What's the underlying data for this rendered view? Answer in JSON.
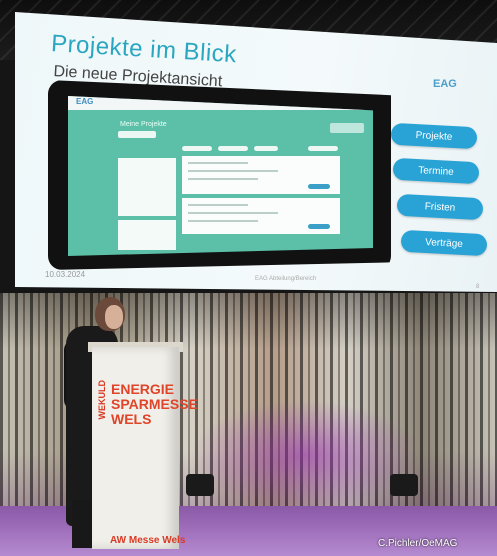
{
  "slide": {
    "title": "Projekte im Blick",
    "subtitle": "Die neue Projektansicht",
    "logo": "EAG",
    "date": "10.03.2024",
    "footer": "EAG Abteilung/Bereich",
    "page": "8",
    "buttons": [
      "Projekte",
      "Termine",
      "Fristen",
      "Verträge"
    ],
    "screen": {
      "logo": "EAG",
      "heading": "Meine Projekte"
    }
  },
  "lectern": {
    "brand_small": "WEKULD",
    "title": "ENERGIE\nSPARMESSE\nWELS",
    "logo": "AW Messe Wels"
  },
  "credit": "C.Pichler/OeMAG",
  "colors": {
    "slide_accent": "#2aa6c0",
    "button_blue": "#29a3d6",
    "screen_green": "#5cc0a8",
    "lectern_red": "#e0452a",
    "stage_purple": "#9c6bb8"
  }
}
